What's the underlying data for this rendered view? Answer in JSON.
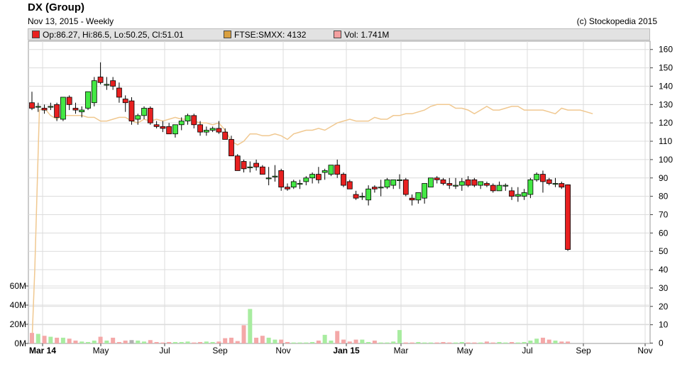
{
  "header": {
    "title": "DX (Group)",
    "subtitle": "Nov 13, 2015 - Weekly",
    "credit": "(c) Stockopedia 2015"
  },
  "legend": {
    "price": {
      "label": "Op:86.27, Hi:86.5, Lo:50.25, Cl:51.01",
      "color": "#e8201e"
    },
    "index": {
      "label": "FTSE:SMXX: 4132",
      "color": "#d9a040"
    },
    "volume": {
      "label": "Vol: 1.741M",
      "color": "#f4a0a0"
    }
  },
  "colors": {
    "up": "#44e844",
    "down": "#e82020",
    "index_line": "#f0c890",
    "vol_up": "#a8eca0",
    "vol_down": "#f4a8a8",
    "vol_neutral": "#b0b0b0",
    "grid": "#dcdcdc"
  },
  "chart_data": {
    "type": "candlestick",
    "price_axis": {
      "ylim": [
        0,
        165
      ],
      "ticks": [
        0,
        10,
        20,
        30,
        40,
        50,
        60,
        70,
        80,
        90,
        100,
        110,
        120,
        130,
        140,
        150,
        160
      ]
    },
    "volume_axis": {
      "ylim": [
        0,
        70
      ],
      "ticks": [
        "0M",
        "20M",
        "40M",
        "60M"
      ]
    },
    "x_axis_labels": [
      "Mar 14",
      "May",
      "Jul",
      "Sep",
      "Nov",
      "Jan 15",
      "Mar",
      "May",
      "Jul",
      "Sep",
      "Nov"
    ],
    "grid": true,
    "candles": [
      [
        131,
        137,
        127,
        128
      ],
      [
        129,
        131,
        126,
        129
      ],
      [
        128,
        130,
        125,
        127
      ],
      [
        129,
        131,
        127,
        129
      ],
      [
        130,
        131,
        121,
        123
      ],
      [
        122,
        134,
        121,
        134
      ],
      [
        134,
        135,
        127,
        130
      ],
      [
        128,
        131,
        125,
        127
      ],
      [
        126,
        129,
        123,
        127
      ],
      [
        128,
        137,
        127,
        137
      ],
      [
        131,
        145,
        129,
        143
      ],
      [
        145,
        153,
        141,
        142
      ],
      [
        141,
        145,
        138,
        141
      ],
      [
        143,
        145,
        138,
        140
      ],
      [
        139,
        142,
        131,
        134
      ],
      [
        133,
        135,
        126,
        131
      ],
      [
        132,
        134,
        119,
        121
      ],
      [
        122,
        125,
        119,
        124
      ],
      [
        124,
        129,
        122,
        128
      ],
      [
        128,
        129,
        119,
        120
      ],
      [
        119,
        121,
        117,
        118
      ],
      [
        118,
        121,
        115,
        117
      ],
      [
        118,
        120,
        114,
        114
      ],
      [
        114,
        119,
        112,
        119
      ],
      [
        119,
        123,
        116,
        121
      ],
      [
        121,
        125,
        119,
        124
      ],
      [
        124,
        125,
        117,
        119
      ],
      [
        119,
        121,
        113,
        115
      ],
      [
        115,
        118,
        113,
        116
      ],
      [
        116,
        118,
        115,
        117
      ],
      [
        117,
        121,
        114,
        115
      ],
      [
        115,
        117,
        111,
        111
      ],
      [
        111,
        113,
        102,
        102
      ],
      [
        102,
        103,
        94,
        94
      ],
      [
        99,
        100,
        93,
        95
      ],
      [
        96,
        99,
        93,
        96
      ],
      [
        98,
        100,
        94,
        96
      ],
      [
        96,
        97,
        92,
        92
      ],
      [
        90,
        96,
        86,
        90
      ],
      [
        91,
        97,
        88,
        91
      ],
      [
        94,
        95,
        83,
        85
      ],
      [
        85,
        87,
        83,
        84
      ],
      [
        85,
        89,
        84,
        88
      ],
      [
        87,
        89,
        84,
        87
      ],
      [
        88,
        91,
        86,
        90
      ],
      [
        90,
        93,
        87,
        92
      ],
      [
        92,
        96,
        87,
        89
      ],
      [
        93,
        95,
        89,
        94
      ],
      [
        92,
        97,
        91,
        97
      ],
      [
        97,
        100,
        90,
        92
      ],
      [
        92,
        93,
        85,
        86
      ],
      [
        88,
        89,
        84,
        84
      ],
      [
        81,
        83,
        78,
        79
      ],
      [
        80,
        82,
        78,
        80
      ],
      [
        78,
        86,
        75,
        84
      ],
      [
        85,
        86,
        82,
        84
      ],
      [
        85,
        89,
        80,
        85
      ],
      [
        85,
        90,
        84,
        89
      ],
      [
        86,
        89,
        84,
        89
      ],
      [
        89,
        92,
        84,
        89
      ],
      [
        89,
        90,
        80,
        81
      ],
      [
        79,
        81,
        75,
        78
      ],
      [
        78,
        82,
        76,
        82
      ],
      [
        79,
        87,
        76,
        87
      ],
      [
        85,
        90,
        85,
        90
      ],
      [
        90,
        91,
        87,
        89
      ],
      [
        89,
        90,
        86,
        87
      ],
      [
        87,
        90,
        84,
        86
      ],
      [
        86,
        90,
        84,
        86
      ],
      [
        86,
        90,
        83,
        88
      ],
      [
        89,
        91,
        85,
        86
      ],
      [
        89,
        90,
        85,
        86
      ],
      [
        86,
        88,
        84,
        88
      ],
      [
        87,
        88,
        85,
        86
      ],
      [
        86,
        87,
        82,
        83
      ],
      [
        83,
        88,
        83,
        86
      ],
      [
        86,
        87,
        83,
        86
      ],
      [
        83,
        85,
        78,
        80
      ],
      [
        80,
        85,
        77,
        81
      ],
      [
        80,
        84,
        78,
        82
      ],
      [
        81,
        90,
        79,
        89
      ],
      [
        89,
        93,
        88,
        92
      ],
      [
        92,
        94,
        82,
        88
      ],
      [
        89,
        90,
        86,
        87
      ],
      [
        87,
        90,
        85,
        87
      ],
      [
        87,
        88,
        84,
        85
      ],
      [
        86.27,
        86.5,
        50.25,
        51.01
      ]
    ],
    "volume": [
      11,
      10,
      8,
      7,
      6,
      6,
      5,
      3,
      2,
      1.5,
      3,
      7,
      3,
      6,
      1.5,
      3,
      3.5,
      3,
      2,
      3.5,
      1.5,
      1,
      1.5,
      1.5,
      1.5,
      2,
      1,
      1.5,
      2,
      1.5,
      2,
      5.5,
      6,
      2.5,
      19,
      36,
      6,
      8,
      6,
      4,
      4,
      1.5,
      1,
      1,
      1,
      1.5,
      3,
      9,
      3,
      13,
      4,
      2,
      4,
      4,
      1.5,
      3,
      1,
      1,
      2,
      14,
      1,
      1,
      1.5,
      1,
      1,
      1,
      1.5,
      1,
      1,
      1.5,
      1,
      1,
      1,
      2,
      1,
      1.5,
      1,
      1.5,
      1,
      1.5,
      3,
      5,
      6,
      4,
      3,
      2,
      2
    ],
    "index_series": [
      {
        "x": 0,
        "y": 0
      },
      {
        "x": 0.45,
        "y": 40
      },
      {
        "x": 1.2,
        "y": 127
      },
      {
        "x": 2,
        "y": 128
      },
      {
        "x": 3,
        "y": 124
      },
      {
        "x": 4,
        "y": 122
      },
      {
        "x": 5,
        "y": 124
      },
      {
        "x": 6,
        "y": 124
      },
      {
        "x": 7,
        "y": 124
      },
      {
        "x": 8,
        "y": 124
      },
      {
        "x": 9,
        "y": 123
      },
      {
        "x": 10,
        "y": 123
      },
      {
        "x": 11,
        "y": 121
      },
      {
        "x": 12,
        "y": 121
      },
      {
        "x": 13,
        "y": 122
      },
      {
        "x": 14,
        "y": 123
      },
      {
        "x": 15,
        "y": 123
      },
      {
        "x": 16,
        "y": 121
      },
      {
        "x": 17,
        "y": 120
      },
      {
        "x": 18,
        "y": 122
      },
      {
        "x": 19,
        "y": 121
      },
      {
        "x": 20,
        "y": 122
      },
      {
        "x": 21,
        "y": 121
      },
      {
        "x": 22,
        "y": 122
      },
      {
        "x": 23,
        "y": 123
      },
      {
        "x": 24,
        "y": 122
      },
      {
        "x": 25,
        "y": 122
      },
      {
        "x": 26,
        "y": 121
      },
      {
        "x": 27,
        "y": 120
      },
      {
        "x": 28,
        "y": 120
      },
      {
        "x": 29,
        "y": 119
      },
      {
        "x": 30,
        "y": 120
      },
      {
        "x": 31,
        "y": 116
      },
      {
        "x": 32,
        "y": 110
      },
      {
        "x": 33,
        "y": 108
      },
      {
        "x": 34,
        "y": 110
      },
      {
        "x": 35,
        "y": 114
      },
      {
        "x": 36,
        "y": 114
      },
      {
        "x": 37,
        "y": 113
      },
      {
        "x": 38,
        "y": 113
      },
      {
        "x": 39,
        "y": 114
      },
      {
        "x": 40,
        "y": 113
      },
      {
        "x": 41,
        "y": 111
      },
      {
        "x": 42,
        "y": 114
      },
      {
        "x": 43,
        "y": 115
      },
      {
        "x": 44,
        "y": 116
      },
      {
        "x": 45,
        "y": 116
      },
      {
        "x": 46,
        "y": 117
      },
      {
        "x": 47,
        "y": 116
      },
      {
        "x": 48,
        "y": 118
      },
      {
        "x": 49,
        "y": 120
      },
      {
        "x": 50,
        "y": 121
      },
      {
        "x": 51,
        "y": 122
      },
      {
        "x": 52,
        "y": 121
      },
      {
        "x": 53,
        "y": 121
      },
      {
        "x": 54,
        "y": 121
      },
      {
        "x": 55,
        "y": 123
      },
      {
        "x": 56,
        "y": 122
      },
      {
        "x": 57,
        "y": 122
      },
      {
        "x": 58,
        "y": 124
      },
      {
        "x": 59,
        "y": 124
      },
      {
        "x": 60,
        "y": 125
      },
      {
        "x": 61,
        "y": 125
      },
      {
        "x": 62,
        "y": 126
      },
      {
        "x": 63,
        "y": 127
      },
      {
        "x": 64,
        "y": 129
      },
      {
        "x": 65,
        "y": 130
      },
      {
        "x": 66,
        "y": 130
      },
      {
        "x": 67,
        "y": 130
      },
      {
        "x": 68,
        "y": 128
      },
      {
        "x": 69,
        "y": 128
      },
      {
        "x": 70,
        "y": 127
      },
      {
        "x": 71,
        "y": 125
      },
      {
        "x": 72,
        "y": 127
      },
      {
        "x": 73,
        "y": 129
      },
      {
        "x": 74,
        "y": 127
      },
      {
        "x": 75,
        "y": 127
      },
      {
        "x": 76,
        "y": 128
      },
      {
        "x": 77,
        "y": 129
      },
      {
        "x": 78,
        "y": 129
      },
      {
        "x": 79,
        "y": 127
      },
      {
        "x": 80,
        "y": 127
      },
      {
        "x": 81,
        "y": 127
      },
      {
        "x": 82,
        "y": 127
      },
      {
        "x": 83,
        "y": 126
      },
      {
        "x": 84,
        "y": 125
      },
      {
        "x": 85,
        "y": 128
      },
      {
        "x": 86,
        "y": 127
      },
      {
        "x": 87,
        "y": 127
      },
      {
        "x": 88,
        "y": 127
      },
      {
        "x": 89,
        "y": 126
      },
      {
        "x": 90,
        "y": 125
      }
    ]
  }
}
